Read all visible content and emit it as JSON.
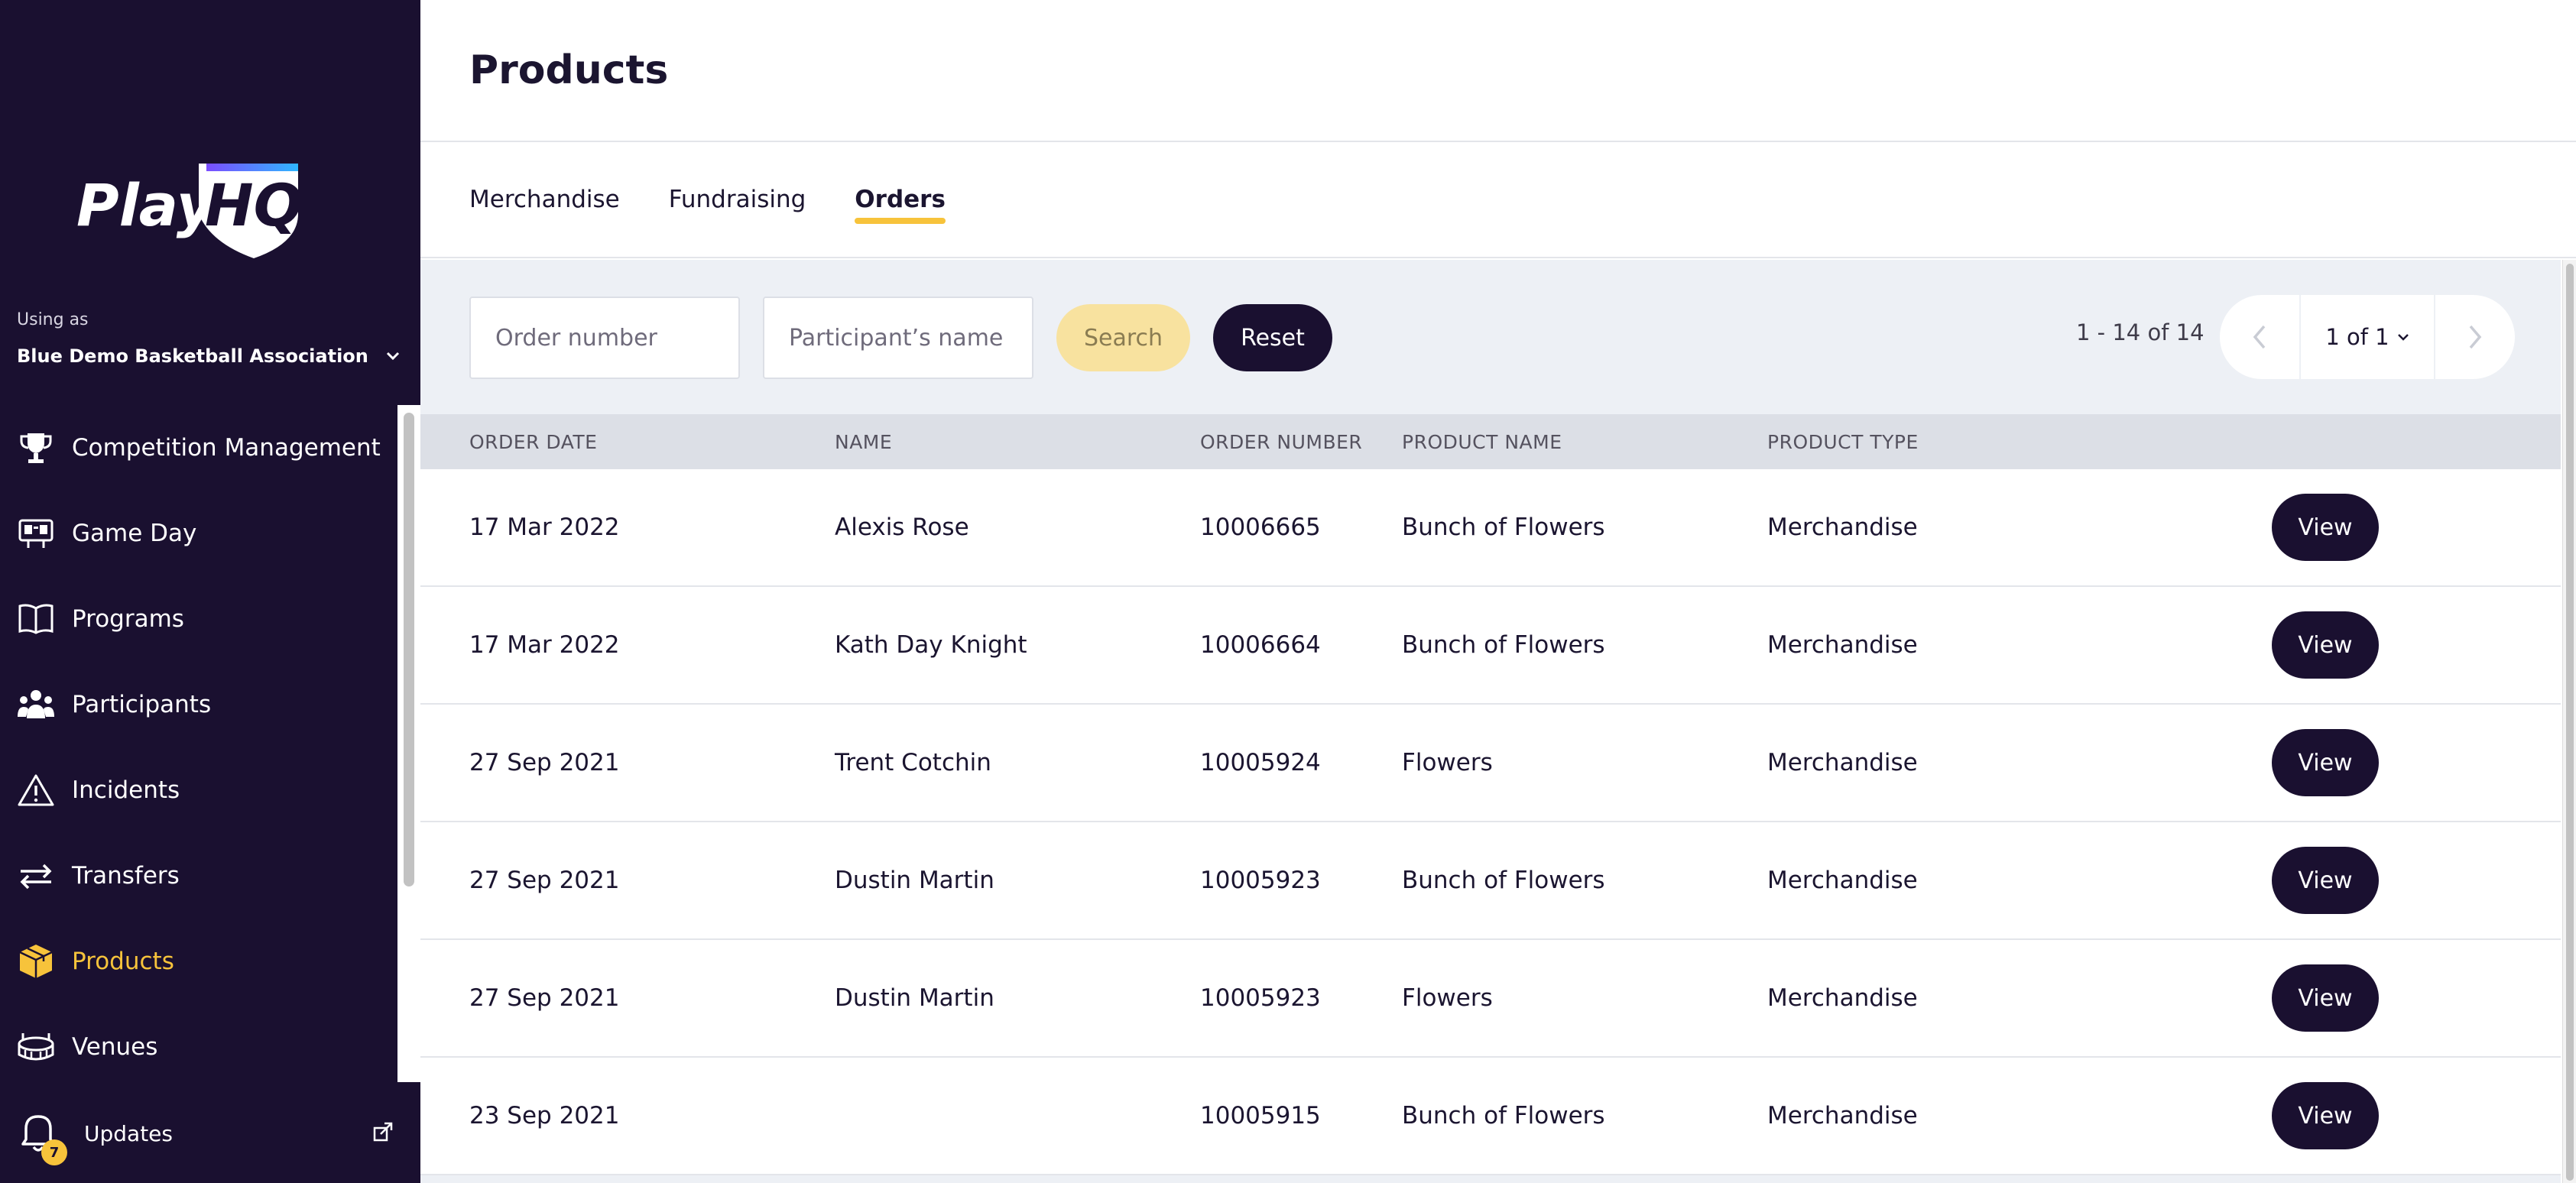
{
  "sidebar": {
    "using_as_label": "Using as",
    "org_name": "Blue Demo Basketball Association",
    "items": [
      {
        "label": "Competition Management",
        "icon": "trophy-icon"
      },
      {
        "label": "Game Day",
        "icon": "scoreboard-icon"
      },
      {
        "label": "Programs",
        "icon": "book-icon"
      },
      {
        "label": "Participants",
        "icon": "people-icon"
      },
      {
        "label": "Incidents",
        "icon": "warning-icon"
      },
      {
        "label": "Transfers",
        "icon": "transfer-arrows-icon"
      },
      {
        "label": "Products",
        "icon": "box-icon",
        "active": true
      },
      {
        "label": "Venues",
        "icon": "stadium-icon"
      }
    ],
    "updates_label": "Updates",
    "updates_count": "7"
  },
  "header": {
    "title": "Products"
  },
  "tabs": [
    {
      "label": "Merchandise"
    },
    {
      "label": "Fundraising"
    },
    {
      "label": "Orders",
      "active": true
    }
  ],
  "filters": {
    "order_number_placeholder": "Order number",
    "participant_placeholder": "Participant’s name",
    "search_label": "Search",
    "reset_label": "Reset"
  },
  "pagination": {
    "range": "1 - 14 of 14",
    "page": "1 of 1"
  },
  "table": {
    "headers": [
      "ORDER DATE",
      "NAME",
      "ORDER NUMBER",
      "PRODUCT NAME",
      "PRODUCT TYPE"
    ],
    "view_label": "View",
    "rows": [
      {
        "date": "17 Mar 2022",
        "name": "Alexis Rose",
        "order_number": "10006665",
        "product_name": "Bunch of Flowers",
        "product_type": "Merchandise"
      },
      {
        "date": "17 Mar 2022",
        "name": "Kath Day Knight",
        "order_number": "10006664",
        "product_name": "Bunch of Flowers",
        "product_type": "Merchandise"
      },
      {
        "date": "27 Sep 2021",
        "name": "Trent Cotchin",
        "order_number": "10005924",
        "product_name": "Flowers",
        "product_type": "Merchandise"
      },
      {
        "date": "27 Sep 2021",
        "name": "Dustin Martin",
        "order_number": "10005923",
        "product_name": "Bunch of Flowers",
        "product_type": "Merchandise"
      },
      {
        "date": "27 Sep 2021",
        "name": "Dustin Martin",
        "order_number": "10005923",
        "product_name": "Flowers",
        "product_type": "Merchandise"
      },
      {
        "date": "23 Sep 2021",
        "name": "",
        "order_number": "10005915",
        "product_name": "Bunch of Flowers",
        "product_type": "Merchandise"
      }
    ]
  },
  "colors": {
    "sidebar_bg": "#1a1030",
    "accent": "#f7c33b",
    "content_bg": "#edf0f5"
  }
}
